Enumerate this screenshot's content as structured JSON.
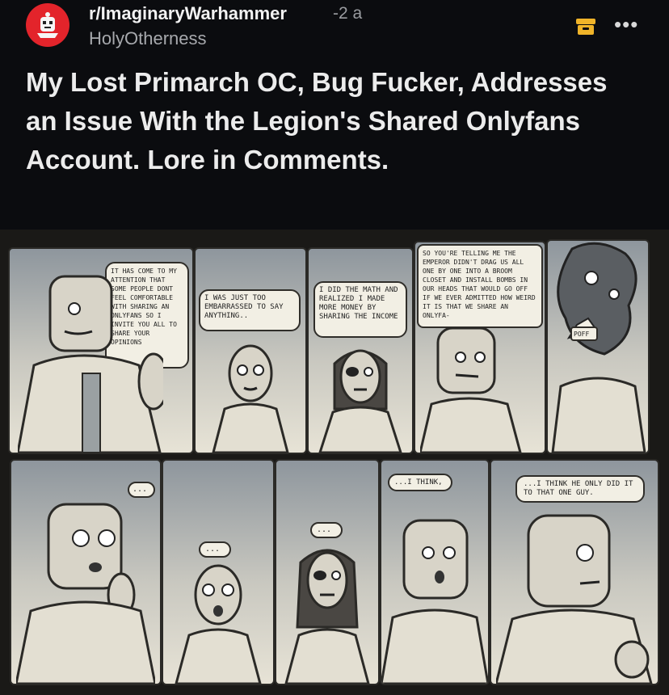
{
  "post": {
    "subreddit": "r/ImaginaryWarhammer",
    "age": "-2 a",
    "username": "HolyOtherness",
    "title": "My Lost Primarch OC, Bug Fucker, Addresses an Issue With the Legion's Shared Onlyfans Account. Lore in Comments.",
    "more_label": "•••"
  },
  "icons": {
    "avatar": "subreddit-avatar-icon",
    "mod": "mod-archive-icon",
    "more": "more-options-icon"
  },
  "colors": {
    "background": "#0b0c0f",
    "avatar_red": "#e3242b",
    "mod_icon": "#f0b429"
  },
  "comic": {
    "panels": [
      {
        "text": "It has come to my attention that some people dont feel comfortable with sharing an onlyfans so I invite you all to share your opinions"
      },
      {
        "text": "I was just too embarrassed to say anything.."
      },
      {
        "text": "I did the math and realized I made more money by sharing the income"
      },
      {
        "text": "So you're telling me the emperor didn't drag us all one by one into a broom closet and install bombs in our heads that would go off if we ever admitted how weird it is that we share an onlyfa-"
      },
      {
        "text": "poff"
      },
      {
        "text": "..."
      },
      {
        "text": "..."
      },
      {
        "text": "..."
      },
      {
        "text": "...I think,"
      },
      {
        "text": "...I think he only did it to that one guy."
      }
    ]
  }
}
